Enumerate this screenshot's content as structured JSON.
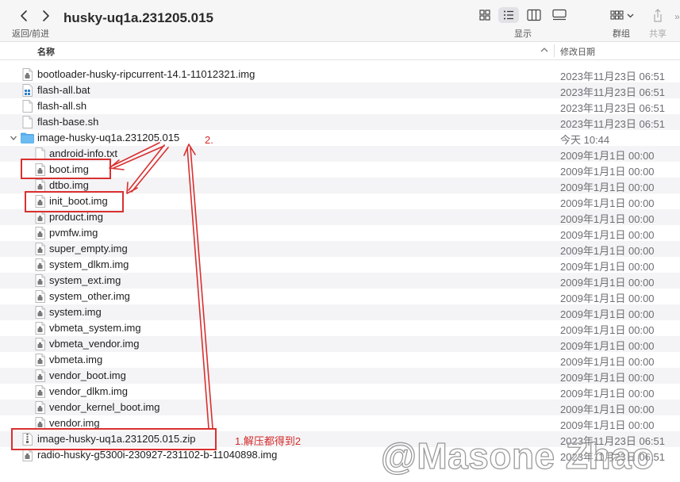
{
  "toolbar": {
    "nav_label": "返回/前进",
    "title": "husky-uq1a.231205.015",
    "view_label": "显示",
    "group_label": "群组",
    "share_label": "共享",
    "more": "»"
  },
  "columns": {
    "name": "名称",
    "date": "修改日期"
  },
  "files": [
    {
      "name": "bootloader-husky-ripcurrent-14.1-11012321.img",
      "date": "2023年11月23日 06:51",
      "icon": "disk-image-icon"
    },
    {
      "name": "flash-all.bat",
      "date": "2023年11月23日 06:51",
      "icon": "batch-file-icon"
    },
    {
      "name": "flash-all.sh",
      "date": "2023年11月23日 06:51",
      "icon": "document-icon"
    },
    {
      "name": "flash-base.sh",
      "date": "2023年11月23日 06:51",
      "icon": "document-icon"
    },
    {
      "name": "image-husky-uq1a.231205.015",
      "date": "今天 10:44",
      "icon": "folder-icon",
      "expanded": true
    },
    {
      "name": "android-info.txt",
      "date": "2009年1月1日 00:00",
      "icon": "document-icon"
    },
    {
      "name": "boot.img",
      "date": "2009年1月1日 00:00",
      "icon": "disk-image-icon"
    },
    {
      "name": "dtbo.img",
      "date": "2009年1月1日 00:00",
      "icon": "disk-image-icon"
    },
    {
      "name": "init_boot.img",
      "date": "2009年1月1日 00:00",
      "icon": "disk-image-icon"
    },
    {
      "name": "product.img",
      "date": "2009年1月1日 00:00",
      "icon": "disk-image-icon"
    },
    {
      "name": "pvmfw.img",
      "date": "2009年1月1日 00:00",
      "icon": "disk-image-icon"
    },
    {
      "name": "super_empty.img",
      "date": "2009年1月1日 00:00",
      "icon": "disk-image-icon"
    },
    {
      "name": "system_dlkm.img",
      "date": "2009年1月1日 00:00",
      "icon": "disk-image-icon"
    },
    {
      "name": "system_ext.img",
      "date": "2009年1月1日 00:00",
      "icon": "disk-image-icon"
    },
    {
      "name": "system_other.img",
      "date": "2009年1月1日 00:00",
      "icon": "disk-image-icon"
    },
    {
      "name": "system.img",
      "date": "2009年1月1日 00:00",
      "icon": "disk-image-icon"
    },
    {
      "name": "vbmeta_system.img",
      "date": "2009年1月1日 00:00",
      "icon": "disk-image-icon"
    },
    {
      "name": "vbmeta_vendor.img",
      "date": "2009年1月1日 00:00",
      "icon": "disk-image-icon"
    },
    {
      "name": "vbmeta.img",
      "date": "2009年1月1日 00:00",
      "icon": "disk-image-icon"
    },
    {
      "name": "vendor_boot.img",
      "date": "2009年1月1日 00:00",
      "icon": "disk-image-icon"
    },
    {
      "name": "vendor_dlkm.img",
      "date": "2009年1月1日 00:00",
      "icon": "disk-image-icon"
    },
    {
      "name": "vendor_kernel_boot.img",
      "date": "2009年1月1日 00:00",
      "icon": "disk-image-icon"
    },
    {
      "name": "vendor.img",
      "date": "2009年1月1日 00:00",
      "icon": "disk-image-icon"
    },
    {
      "name": "image-husky-uq1a.231205.015.zip",
      "date": "2023年11月23日 06:51",
      "icon": "zip-archive-icon"
    },
    {
      "name": "radio-husky-g5300i-230927-231102-b-11040898.img",
      "date": "2023年11月23日 06:51",
      "icon": "disk-image-icon"
    }
  ],
  "annotations": {
    "step1": "1.解压都得到2",
    "step2": "2.",
    "color": "#d93030"
  },
  "watermark": "@Masone Zhao",
  "colors": {
    "folder": "#5ab0f0",
    "annotation": "#d93030",
    "stripe": "#f4f4f6"
  }
}
